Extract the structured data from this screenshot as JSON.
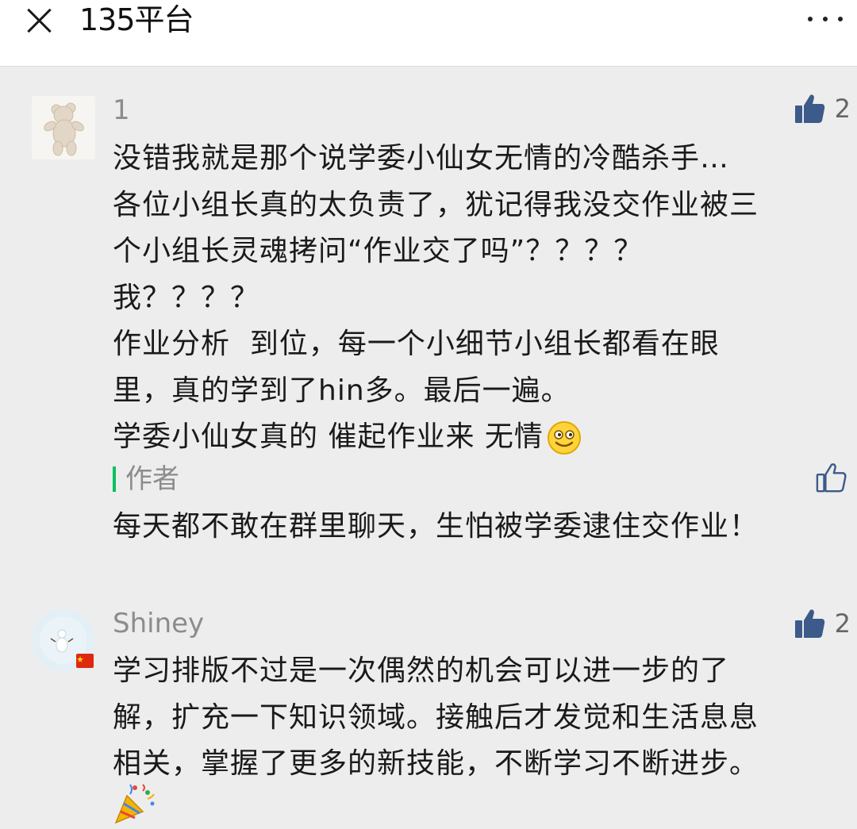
{
  "header": {
    "title": "135平台",
    "close_icon": "close-icon",
    "more_icon": "more-icon"
  },
  "comments": [
    {
      "username": "1",
      "likes": "2",
      "lines": [
        "没错我就是那个说学委小仙女无情的冷酷杀手…",
        "各位小组长真的太负责了，犹记得我没交作业被三",
        "个小组长灵魂拷问“作业交了吗”？？？？",
        "我？？？？",
        "作业分析  到位，每一个小细节小组长都看在眼",
        "里，真的学到了hin多。最后一遍。",
        "学委小仙女真的 催起作业来 无情"
      ],
      "emoji": "smile-emoji",
      "reply": {
        "label": "作者",
        "text": "每天都不敢在群里聊天，生怕被学委逮住交作业！"
      }
    },
    {
      "username": "Shiney",
      "likes": "2",
      "lines": [
        "学习排版不过是一次偶然的机会可以进一步的了",
        "解，扩充一下知识领域。接触后才发觉和生活息息",
        "相关，掌握了更多的新技能，不断学习不断进步。"
      ],
      "emoji": "party-popper-emoji"
    }
  ],
  "colors": {
    "accent": "#07c160",
    "like": "#3c5a8a",
    "meta": "#8c8c8c"
  }
}
